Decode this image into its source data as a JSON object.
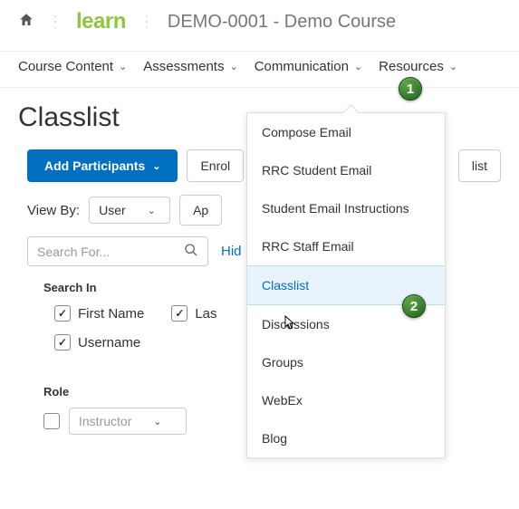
{
  "topbar": {
    "logo": "learn",
    "course_title": "DEMO-0001 - Demo Course"
  },
  "nav": {
    "content": "Course Content",
    "assessments": "Assessments",
    "communication": "Communication",
    "resources": "Resources"
  },
  "page_title": "Classlist",
  "toolbar": {
    "add": "Add Participants",
    "enrol": "Enrol",
    "list": "list"
  },
  "viewby": {
    "label": "View By:",
    "value": "User",
    "apply": "Ap"
  },
  "search": {
    "placeholder": "Search For...",
    "hide_link": "Hid"
  },
  "search_in": {
    "label": "Search In",
    "first_name": "First Name",
    "last_name": "Las",
    "username": "Username"
  },
  "role": {
    "label": "Role",
    "value": "Instructor"
  },
  "dropdown": {
    "items": [
      "Compose Email",
      "RRC Student Email",
      "Student Email Instructions",
      "RRC Staff Email",
      "Classlist",
      "Discussions",
      "Groups",
      "WebEx",
      "Blog"
    ]
  },
  "badges": {
    "one": "1",
    "two": "2"
  }
}
